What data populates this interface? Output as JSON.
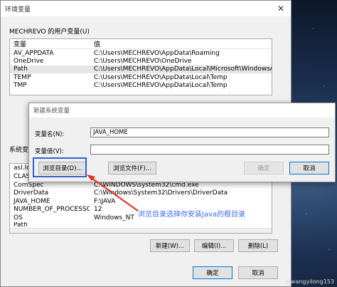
{
  "window": {
    "title": "环境变量"
  },
  "user_vars": {
    "label": "MECHREVO 的用户变量(U)",
    "headers": [
      "变量",
      "值"
    ],
    "rows": [
      {
        "name": "AV_APPDATA",
        "value": "C:\\Users\\MECHREVO\\AppData\\Roaming"
      },
      {
        "name": "OneDrive",
        "value": "C:\\Users\\MECHREVO\\OneDrive"
      },
      {
        "name": "Path",
        "value": "C:\\Users\\MECHREVO\\AppData\\Local\\Microsoft\\WindowsApps;..."
      },
      {
        "name": "TEMP",
        "value": "C:\\Users\\MECHREVO\\AppData\\Local\\Temp"
      },
      {
        "name": "TMP",
        "value": "C:\\Users\\MECHREVO\\AppData\\Local\\Temp"
      }
    ]
  },
  "system_vars": {
    "label": "系统变",
    "partial_rows": [
      "asl.lo",
      "CLAS"
    ],
    "rows": [
      {
        "name": "ComSpec",
        "value": "C:\\WINDOWS\\system32\\cmd.exe"
      },
      {
        "name": "DriverData",
        "value": "C:\\Windows\\System32\\Drivers\\DriverData"
      },
      {
        "name": "JAVA_HOME",
        "value": "F:\\JAVA"
      },
      {
        "name": "NUMBER_OF_PROCESSORS",
        "value": "12"
      },
      {
        "name": "OS",
        "value": "Windows_NT"
      }
    ],
    "cut_row": "Path"
  },
  "system_buttons": {
    "new": "新建(W)...",
    "edit": "编辑(I)...",
    "delete": "删除(L)"
  },
  "footer_buttons": {
    "ok": "确定",
    "cancel": "取消"
  },
  "new_dialog": {
    "title": "新建系统变量",
    "name_label": "变量名(N):",
    "name_value": "JAVA_HOME",
    "value_label": "变量值(V):",
    "value_value": "",
    "browse_dir": "浏览目录(D)...",
    "browse_file": "浏览文件(F)...",
    "ok": "确定",
    "cancel": "取消"
  },
  "annotation": "浏览目录选择你安装Java的根目录",
  "annotation_color": "#3a6df0",
  "watermark": "@wangyilong153"
}
